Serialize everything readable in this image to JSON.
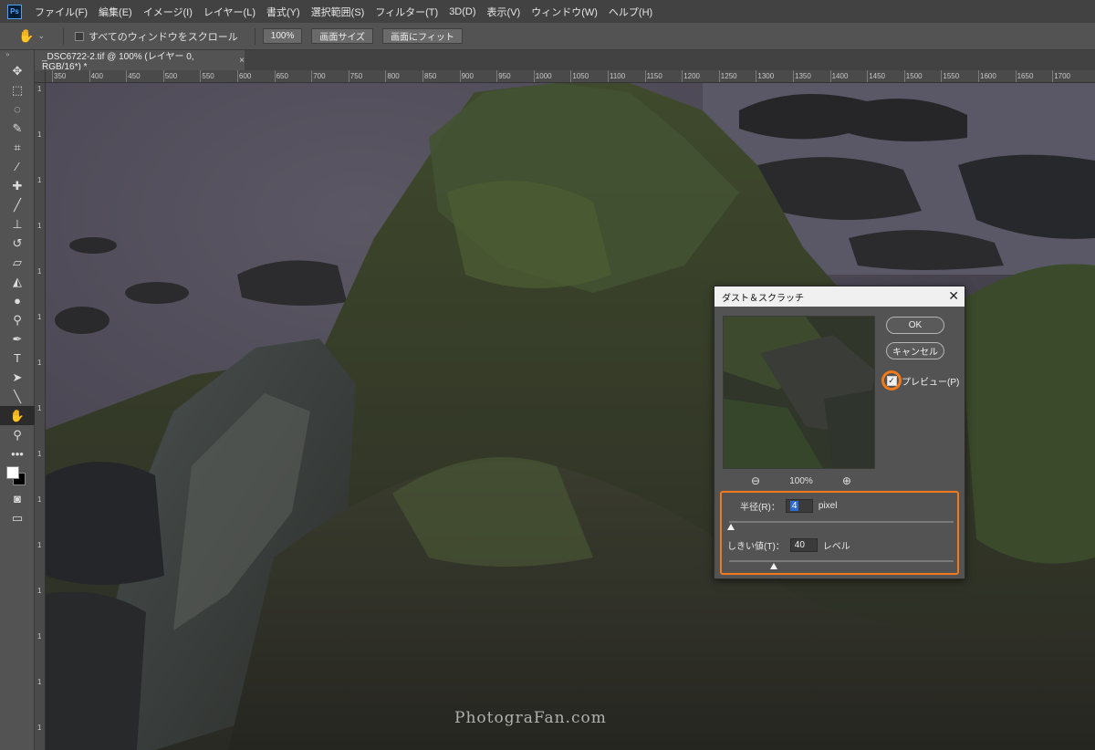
{
  "menu": {
    "logo": "Ps",
    "items": [
      "ファイル(F)",
      "編集(E)",
      "イメージ(I)",
      "レイヤー(L)",
      "書式(Y)",
      "選択範囲(S)",
      "フィルター(T)",
      "3D(D)",
      "表示(V)",
      "ウィンドウ(W)",
      "ヘルプ(H)"
    ]
  },
  "options": {
    "scroll_all_label": "すべてのウィンドウをスクロール",
    "zoom_value": "100%",
    "fit_screen_size_label": "画面サイズ",
    "fit_screen_label": "画面にフィット"
  },
  "document": {
    "tab_title": "_DSC6722-2.tif @ 100% (レイヤー 0, RGB/16*) *",
    "close_glyph": "×"
  },
  "ruler": {
    "h_ticks": [
      "350",
      "400",
      "450",
      "500",
      "550",
      "600",
      "650",
      "700",
      "750",
      "800",
      "850",
      "900",
      "950",
      "1000",
      "1050",
      "1100",
      "1150",
      "1200",
      "1250",
      "1300",
      "1350",
      "1400",
      "1450",
      "1500",
      "1550",
      "1600",
      "1650",
      "1700"
    ],
    "v_ticks": [
      "1",
      "1",
      "1",
      "1",
      "1",
      "1",
      "1",
      "1",
      "1",
      "1",
      "1",
      "1",
      "1",
      "1",
      "1"
    ]
  },
  "dialog": {
    "title": "ダスト＆スクラッチ",
    "close_glyph": "✕",
    "ok_label": "OK",
    "cancel_label": "キャンセル",
    "preview_label": "プレビュー(P)",
    "preview_checked": true,
    "zoom_value": "100%",
    "radius": {
      "label": "半径(R)：",
      "value": "4",
      "unit": "pixel",
      "slider_fraction": 0.01
    },
    "threshold": {
      "label": "しきい値(T)：",
      "value": "40",
      "unit": "レベル",
      "slider_fraction": 0.2
    }
  },
  "watermark": "PhotograFan.com",
  "colors": {
    "highlight": "#f07a1a",
    "menubar_bg": "#424242",
    "panel_bg": "#535353",
    "selection": "#2f6ad1"
  },
  "icons": [
    "ps-logo-icon",
    "hand-icon",
    "move-icon",
    "marquee-icon",
    "lasso-icon",
    "quick-select-icon",
    "crop-icon",
    "eyedropper-icon",
    "healing-brush-icon",
    "brush-icon",
    "stamp-icon",
    "history-brush-icon",
    "eraser-icon",
    "paint-bucket-icon",
    "blur-icon",
    "dodge-icon",
    "pen-icon",
    "type-icon",
    "path-select-icon",
    "line-icon",
    "zoom-icon",
    "more-tools-icon",
    "zoom-out-icon",
    "zoom-in-icon",
    "close-icon",
    "checkbox-icon"
  ]
}
